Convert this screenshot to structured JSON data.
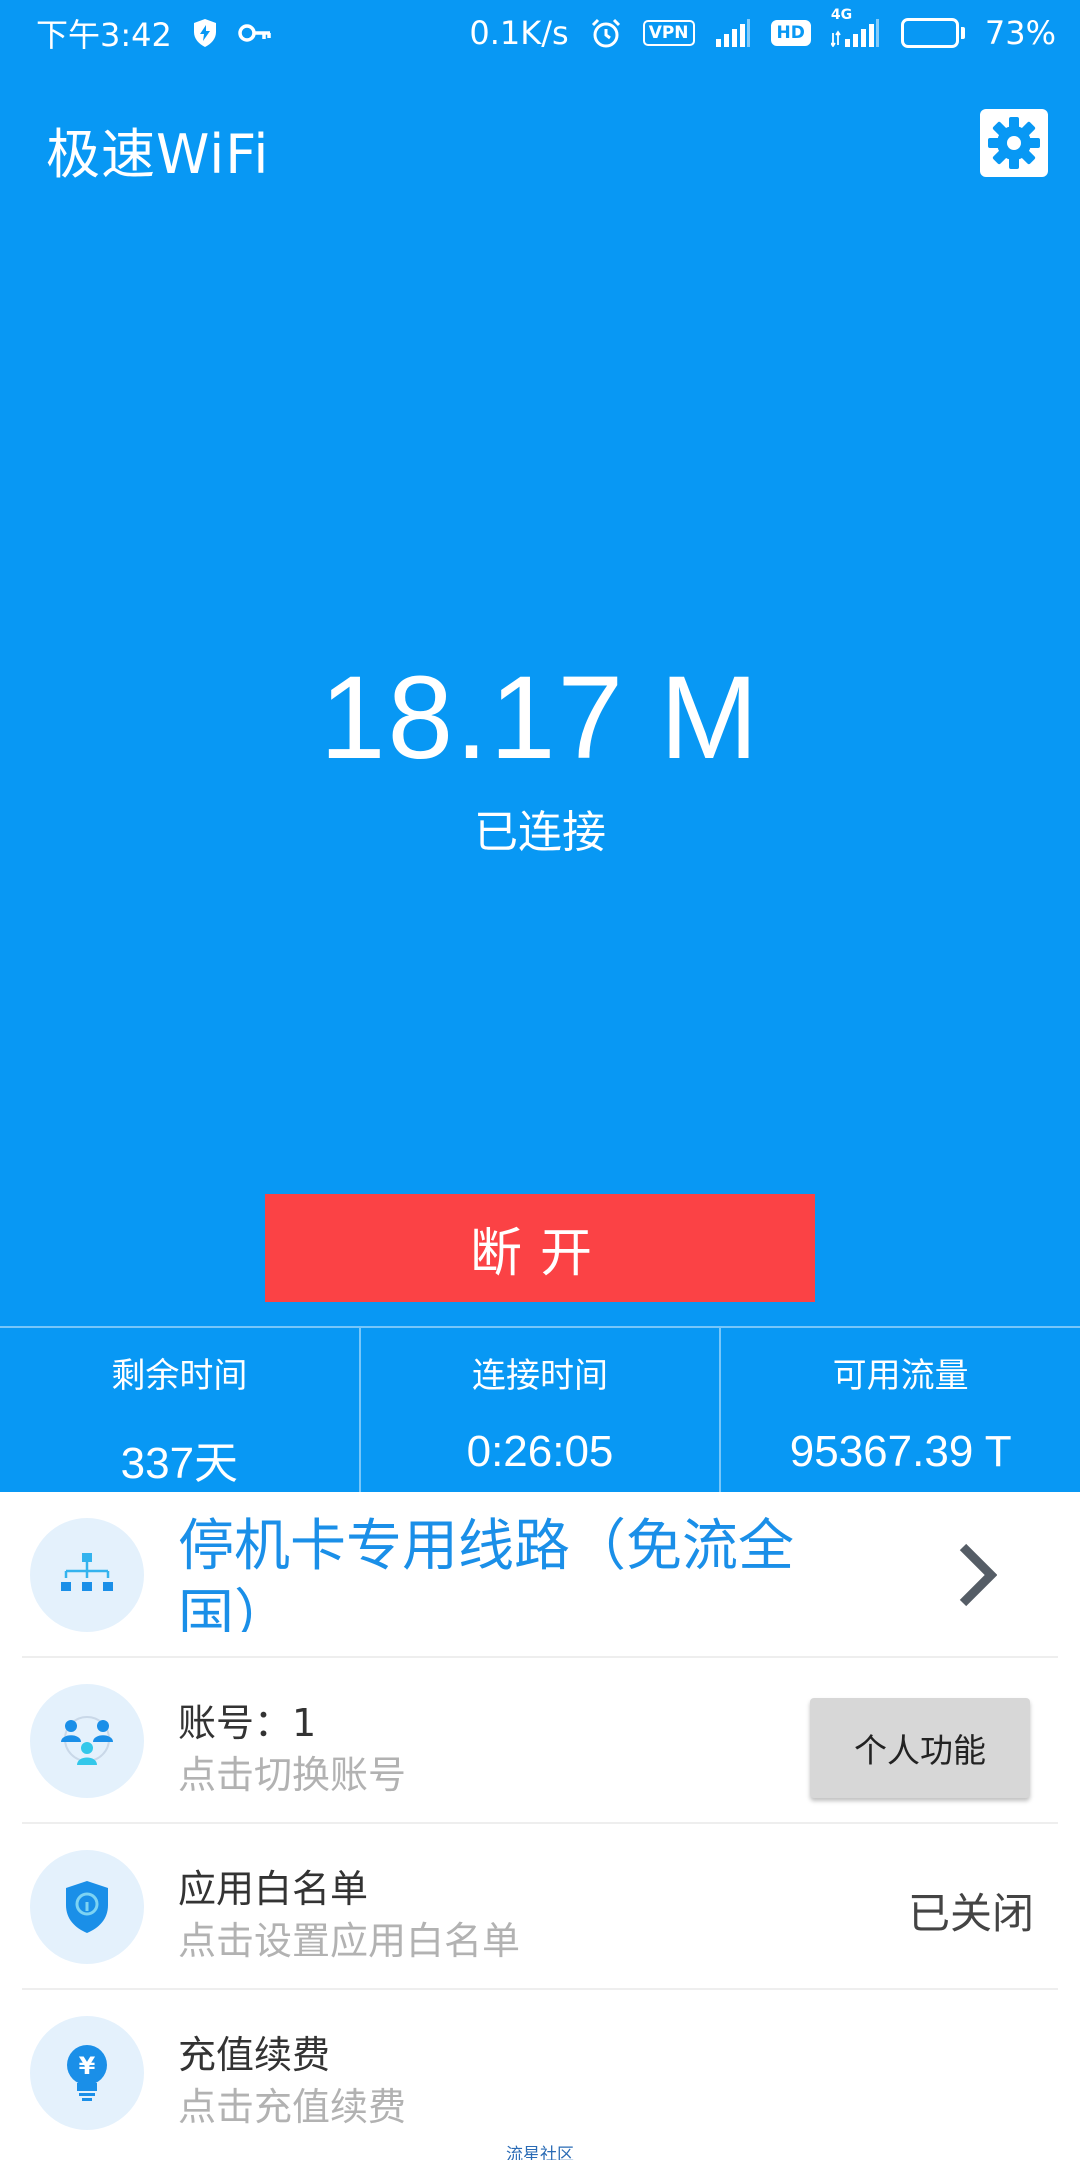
{
  "status_bar": {
    "time": "下午3:42",
    "net_speed": "0.1K/s",
    "vpn": "VPN",
    "hd": "HD",
    "network": "4G",
    "battery_level": 0.73,
    "battery_percent": "73%",
    "icons": [
      "shield-bolt-icon",
      "key-icon",
      "alarm-icon",
      "signal-icon"
    ]
  },
  "app_bar": {
    "title": "极速WiFi",
    "settings_icon": "gear-icon"
  },
  "connection": {
    "speed": "18.17 M",
    "status": "已连接",
    "disconnect_label": "断开"
  },
  "stats": [
    {
      "label": "剩余时间",
      "value": "337天"
    },
    {
      "label": "连接时间",
      "value": "0:26:05"
    },
    {
      "label": "可用流量",
      "value": "95367.39 T"
    }
  ],
  "list": {
    "route": {
      "title": "停机卡专用线路（免流全国）",
      "icon": "network-tree-icon"
    },
    "account": {
      "title": "账号：1",
      "subtitle": "点击切换账号",
      "button": "个人功能",
      "icon": "users-icon"
    },
    "whitelist": {
      "title": "应用白名单",
      "subtitle": "点击设置应用白名单",
      "state": "已关闭",
      "icon": "shield-lock-icon"
    },
    "recharge": {
      "title": "充值续费",
      "subtitle": "点击充值续费",
      "icon": "yuan-bulb-icon"
    }
  },
  "watermark": "流星社区",
  "colors": {
    "primary": "#0898f4",
    "danger": "#fb4245",
    "link": "#1a8fe8"
  }
}
